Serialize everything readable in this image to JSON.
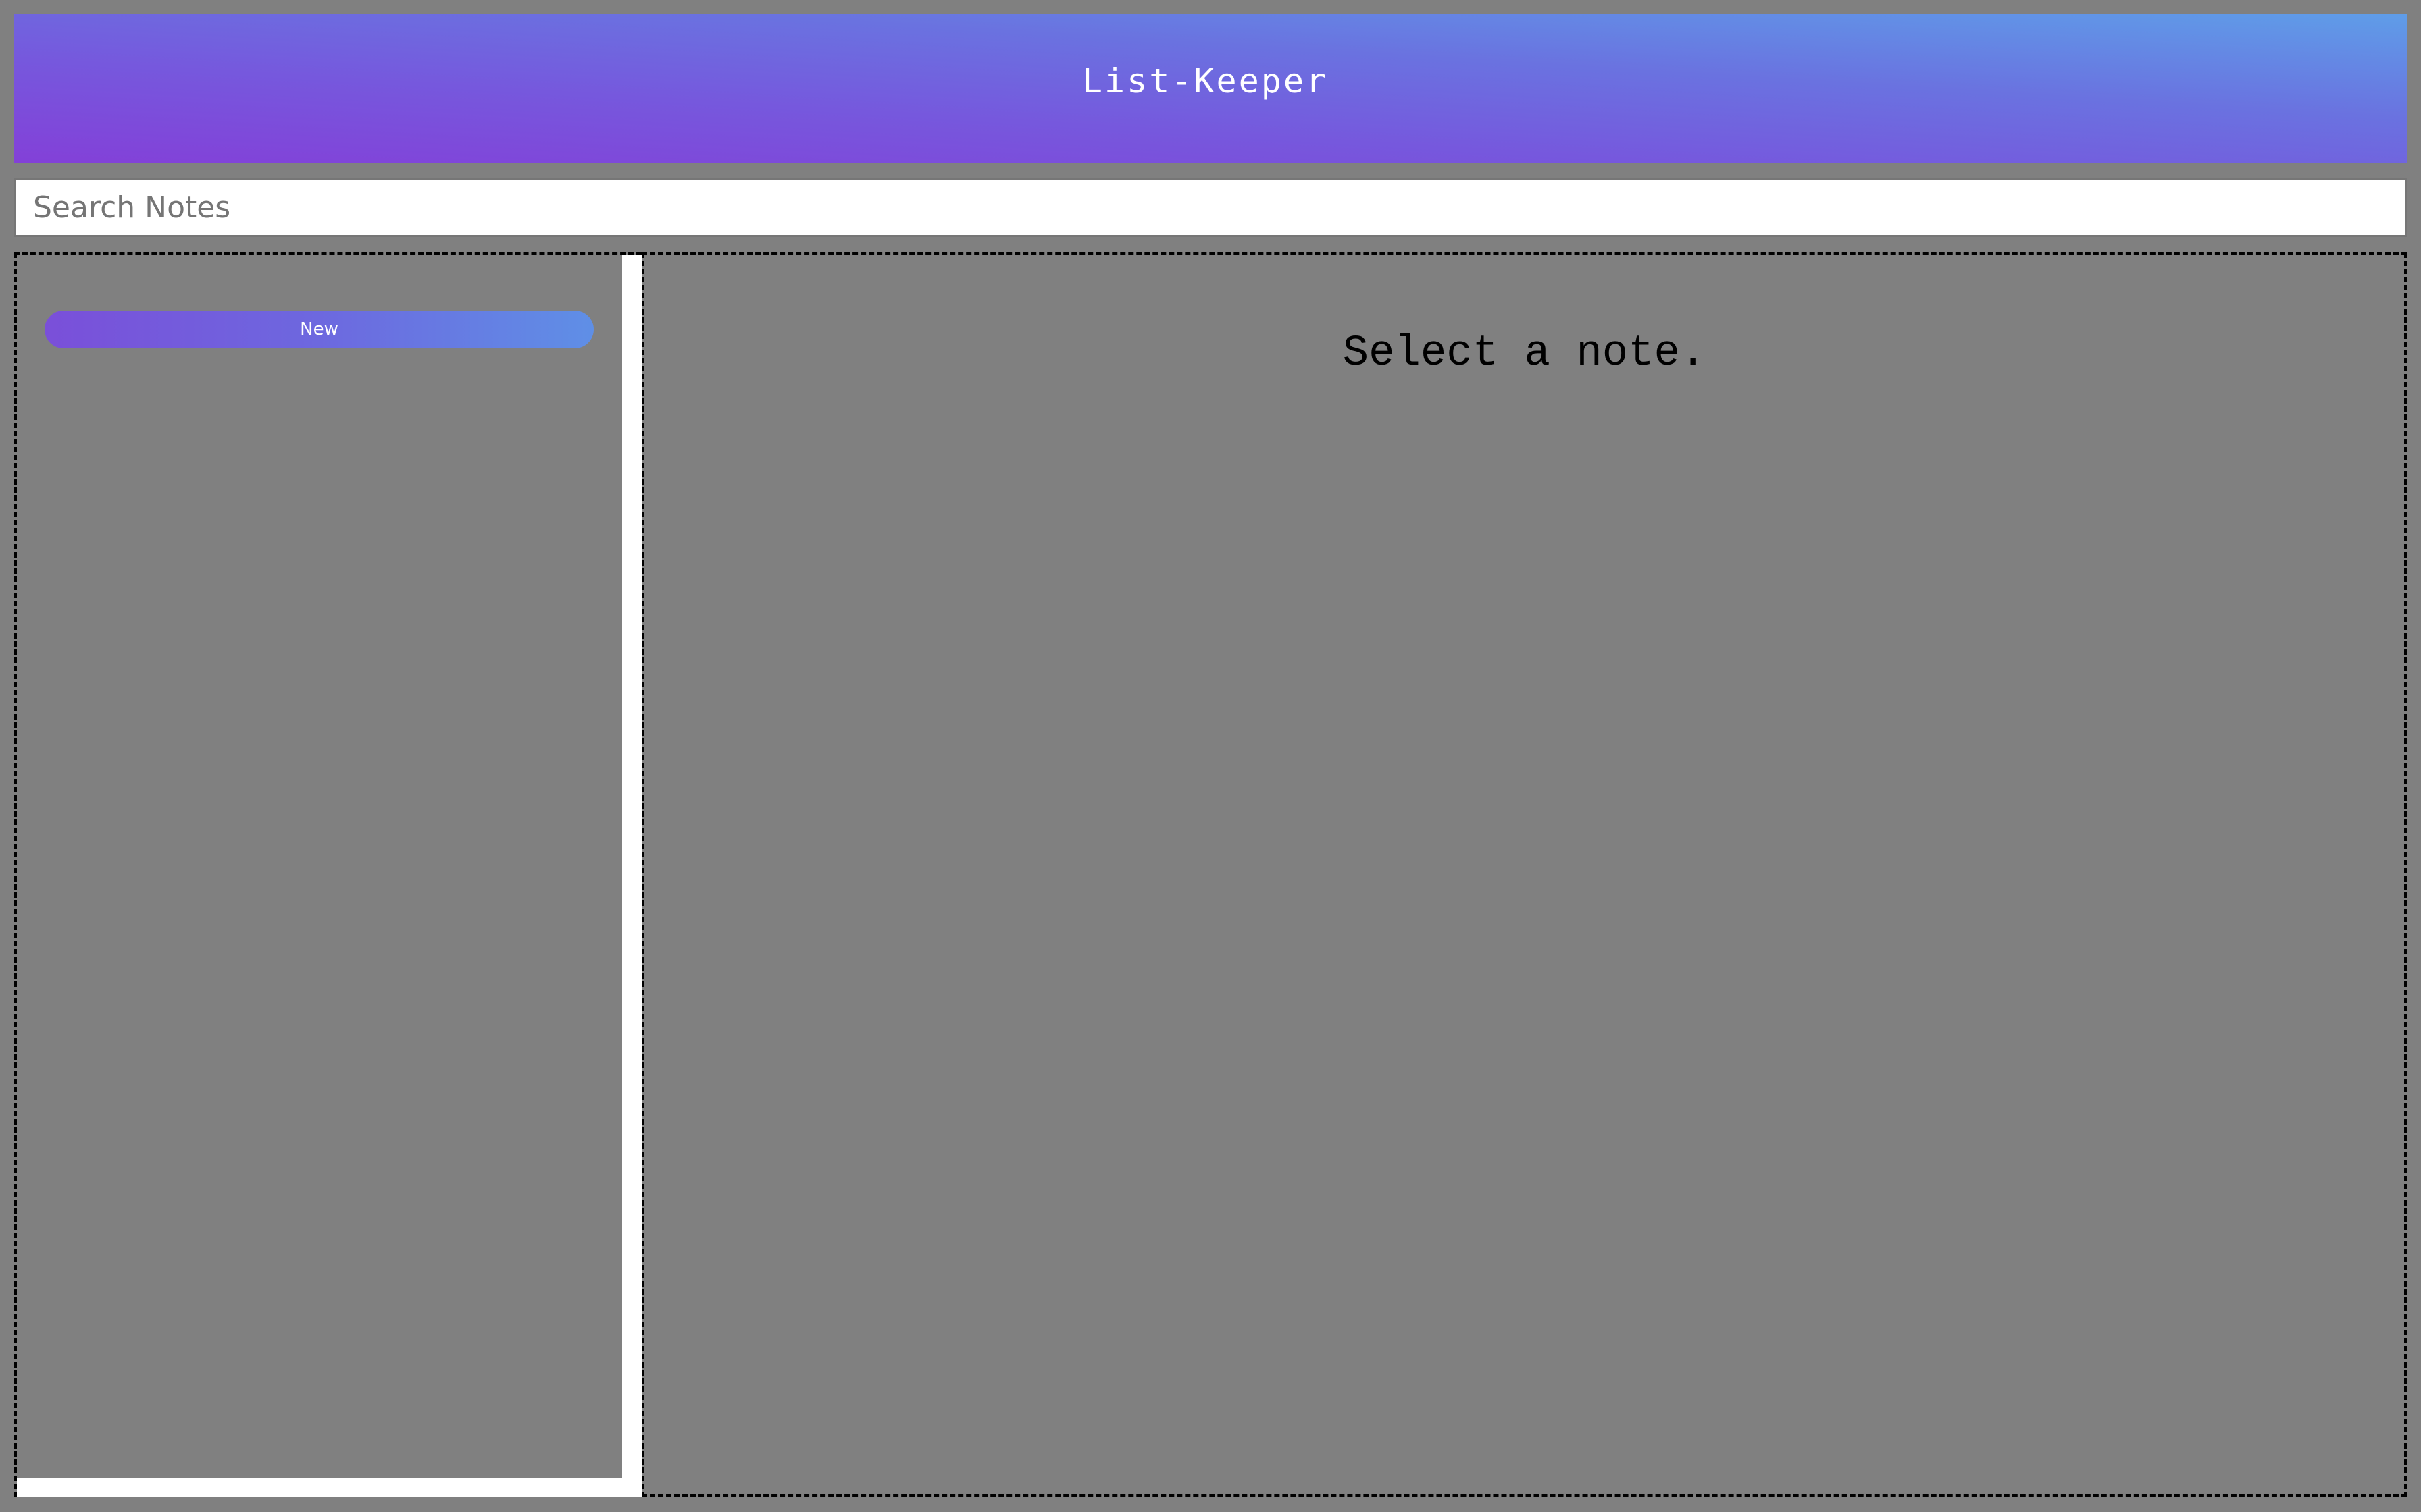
{
  "header": {
    "title": "List-Keeper"
  },
  "search": {
    "placeholder": "Search Notes",
    "value": ""
  },
  "sidebar": {
    "new_button_label": "New"
  },
  "main": {
    "empty_message": "Select a note."
  },
  "colors": {
    "header_gradient_start": "#8340d8",
    "header_gradient_end": "#5f9de8",
    "background": "#808080",
    "button_gradient_start": "#7a4fd9",
    "button_gradient_end": "#5f8fe6"
  }
}
